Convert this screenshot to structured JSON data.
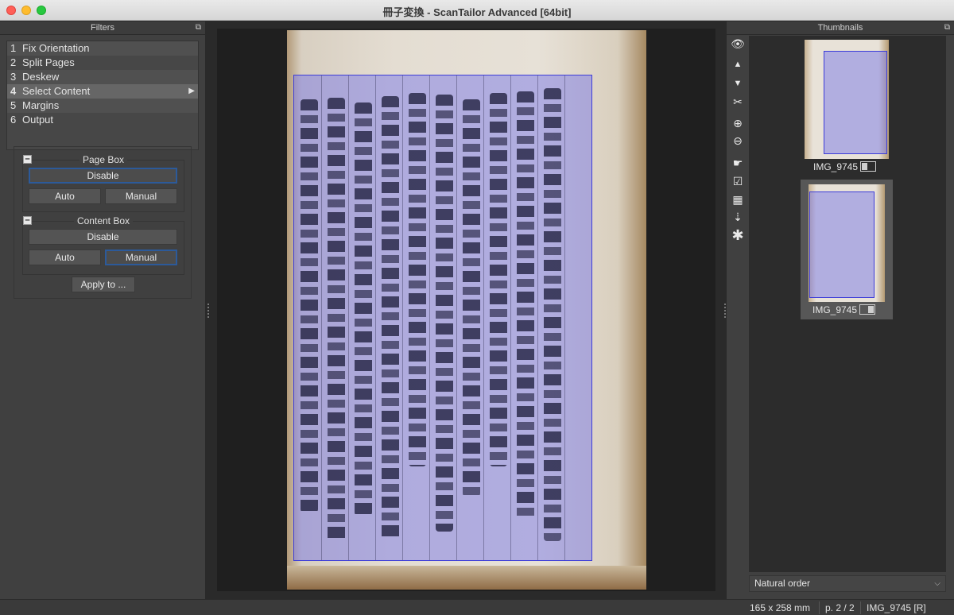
{
  "window": {
    "title": "冊子変換 - ScanTailor Advanced [64bit]"
  },
  "filters_panel": {
    "title": "Filters",
    "items": [
      {
        "num": "1",
        "label": "Fix Orientation"
      },
      {
        "num": "2",
        "label": "Split Pages"
      },
      {
        "num": "3",
        "label": "Deskew"
      },
      {
        "num": "4",
        "label": "Select Content",
        "active": true
      },
      {
        "num": "5",
        "label": "Margins"
      },
      {
        "num": "6",
        "label": "Output"
      }
    ],
    "page_box": {
      "title": "Page Box",
      "disable": "Disable",
      "auto": "Auto",
      "manual": "Manual"
    },
    "content_box": {
      "title": "Content Box",
      "disable": "Disable",
      "auto": "Auto",
      "manual": "Manual"
    },
    "apply_to": "Apply to ..."
  },
  "thumbnails_panel": {
    "title": "Thumbnails",
    "items": [
      {
        "label": "IMG_9745",
        "side": "left-page-icon"
      },
      {
        "label": "IMG_9745",
        "side": "right-page-icon",
        "selected": true
      }
    ],
    "sort_order": "Natural order"
  },
  "toolbar_icons": [
    "eye-icon",
    "arrow-up-icon",
    "arrow-down-icon",
    "scissors-icon",
    "zoom-in-icon",
    "zoom-out-icon",
    "pointing-hand-icon",
    "checkbox-icon",
    "grid-icon",
    "sort-icon",
    "asterisk-icon"
  ],
  "status": {
    "size": "165 x 258 mm",
    "page": "p. 2 / 2",
    "file": "IMG_9745 [R]"
  },
  "colors": {
    "content_box": "#6e6eeb",
    "content_box_border": "#3c3cd8",
    "focus": "#2c5a9a"
  }
}
